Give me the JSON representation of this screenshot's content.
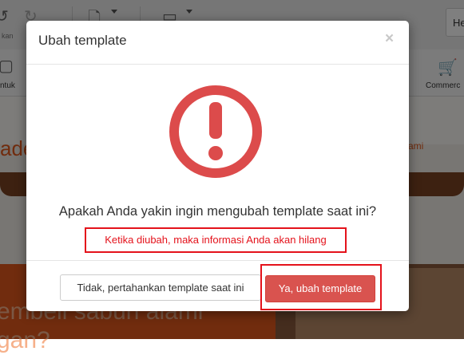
{
  "background": {
    "toolbar": {
      "left_label": "kan",
      "format_label": "ntuk",
      "right_box_text": "He",
      "commerce_label": "Commerc"
    },
    "canvas": {
      "heading_fragment": "ade",
      "link_fragment": "g kami",
      "hero_text_line1": "embeli sabun alami",
      "hero_text_line2": "gan?"
    }
  },
  "modal": {
    "title": "Ubah template",
    "close_symbol": "×",
    "icon": "warning-exclamation-icon",
    "question": "Apakah Anda yakin ingin mengubah template saat ini?",
    "warning": "Ketika diubah, maka informasi Anda akan hilang",
    "cancel_label": "Tidak, pertahankan template saat ini",
    "confirm_label": "Ya, ubah template"
  },
  "colors": {
    "warning_icon": "#dc4b4b",
    "danger_button": "#d9534f",
    "highlight_border": "#e4121b",
    "accent_orange": "#e2591c"
  }
}
